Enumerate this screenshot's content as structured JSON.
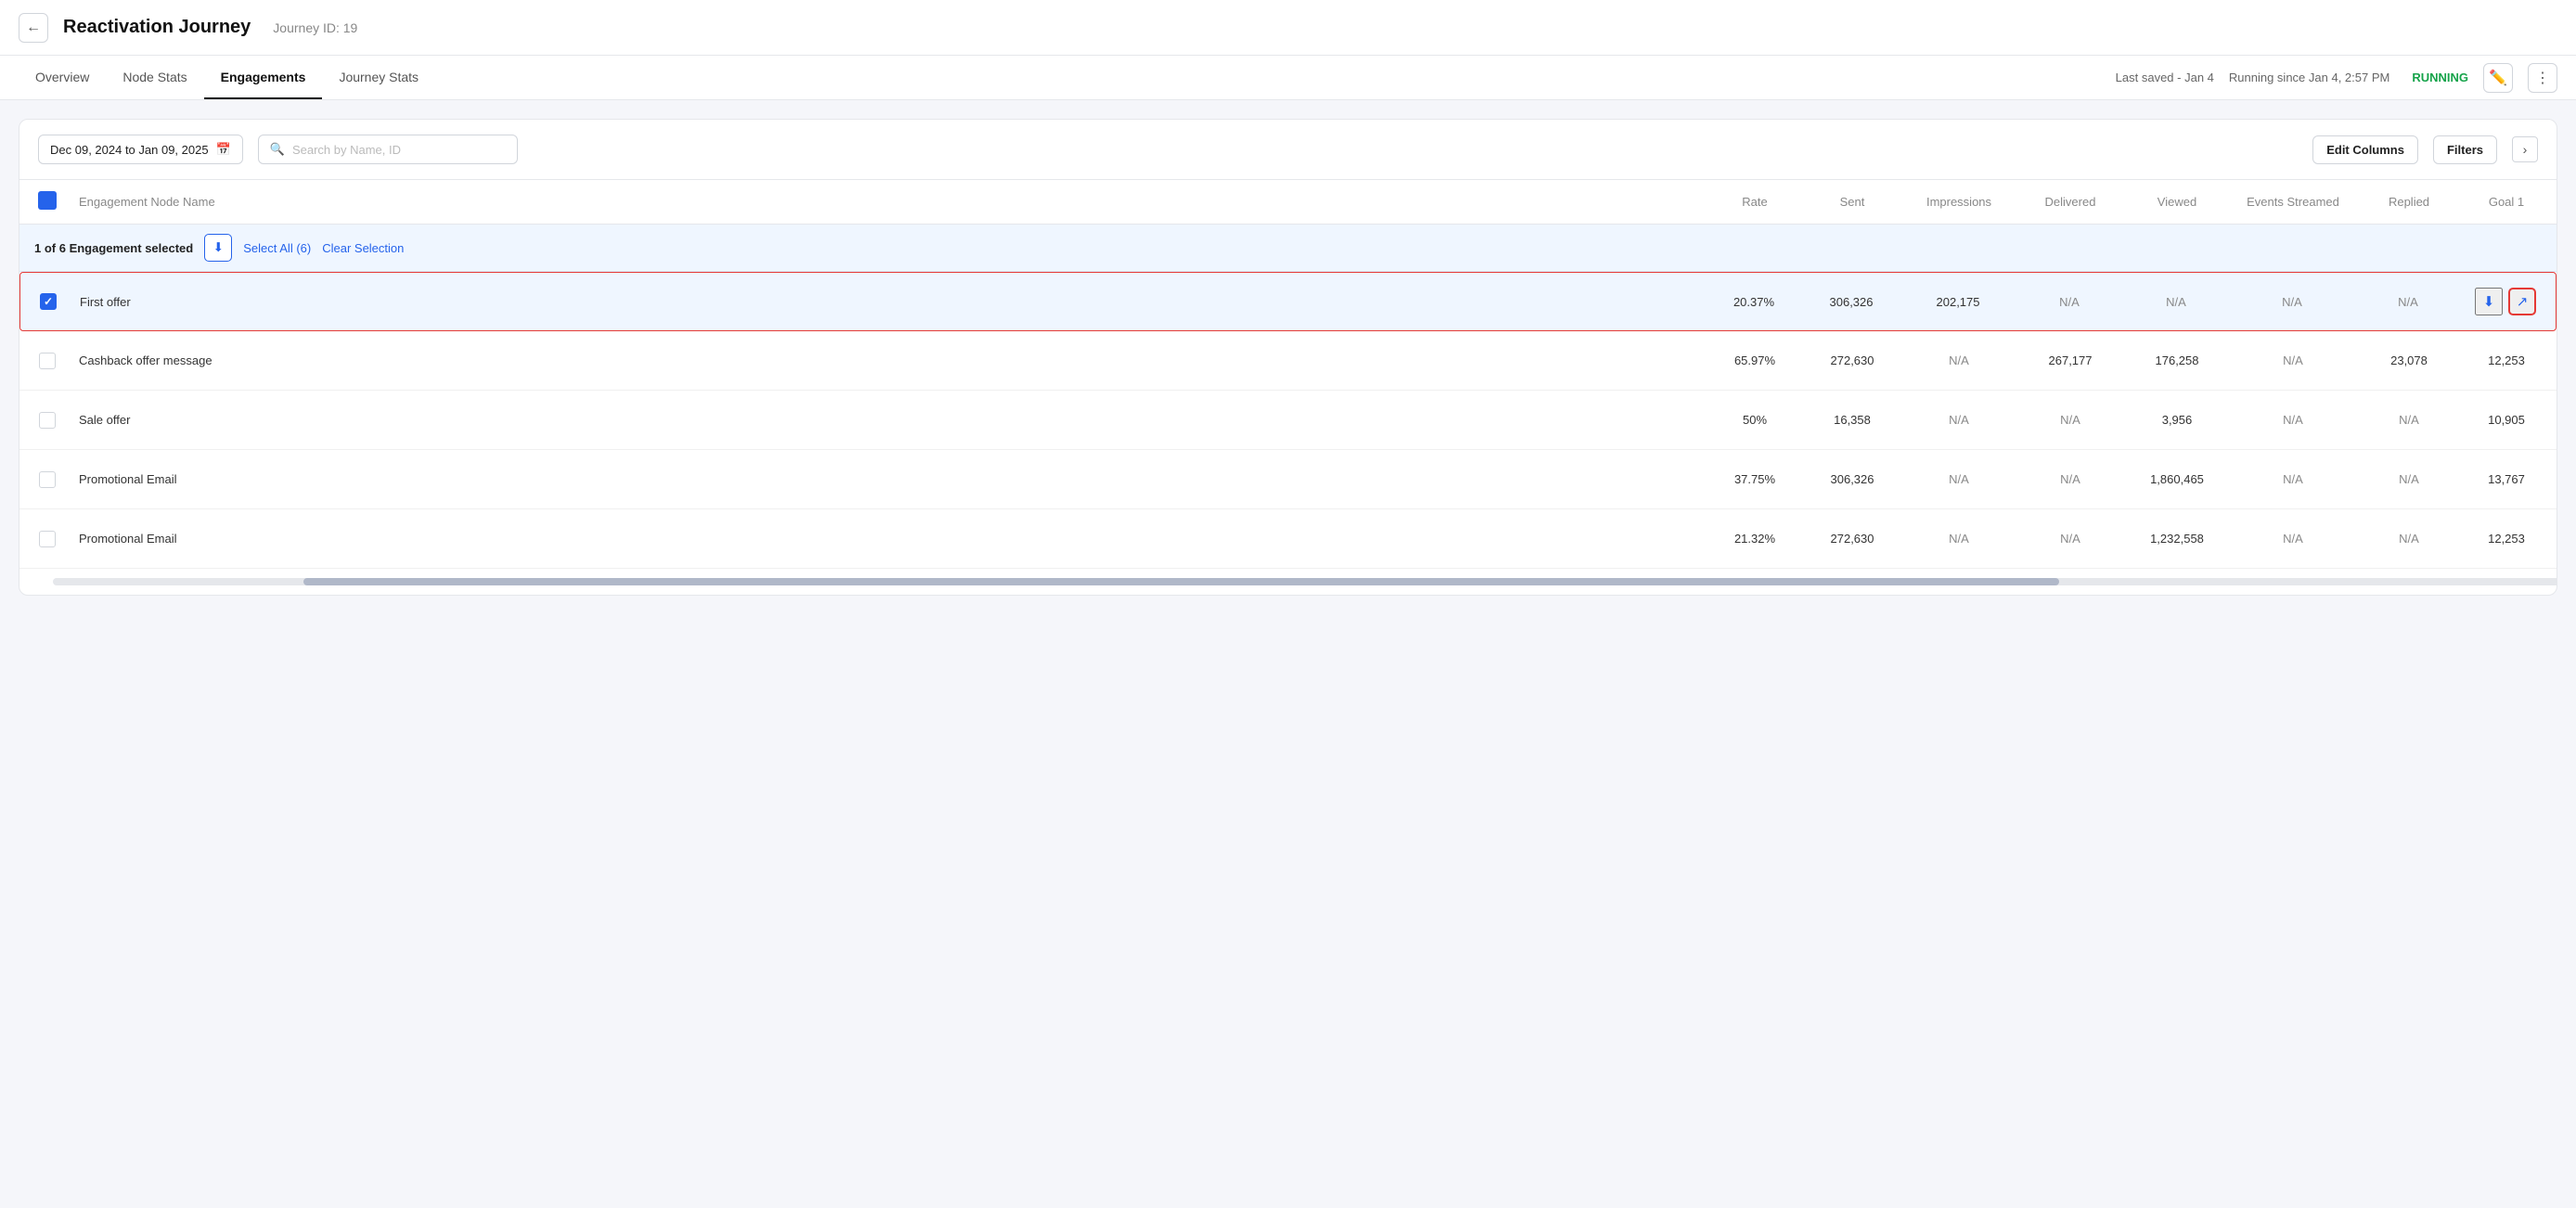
{
  "header": {
    "back_label": "←",
    "title": "Reactivation Journey",
    "journey_id_label": "Journey ID: 19"
  },
  "tabs": [
    {
      "id": "overview",
      "label": "Overview",
      "active": false
    },
    {
      "id": "node-stats",
      "label": "Node Stats",
      "active": false
    },
    {
      "id": "engagements",
      "label": "Engagements",
      "active": true
    },
    {
      "id": "journey-stats",
      "label": "Journey Stats",
      "active": false
    }
  ],
  "status_bar": {
    "last_saved": "Last saved - Jan 4",
    "running_since": "Running since Jan 4, 2:57 PM",
    "status": "RUNNING"
  },
  "toolbar": {
    "date_range": "Dec 09, 2024 to Jan 09, 2025",
    "search_placeholder": "Search by Name, ID",
    "edit_columns_label": "Edit Columns",
    "filters_label": "Filters"
  },
  "table": {
    "columns": [
      {
        "id": "checkbox",
        "label": ""
      },
      {
        "id": "name",
        "label": "Engagement Node Name"
      },
      {
        "id": "rate",
        "label": "Rate"
      },
      {
        "id": "sent",
        "label": "Sent"
      },
      {
        "id": "impressions",
        "label": "Impressions"
      },
      {
        "id": "delivered",
        "label": "Delivered"
      },
      {
        "id": "viewed",
        "label": "Viewed"
      },
      {
        "id": "events_streamed",
        "label": "Events Streamed"
      },
      {
        "id": "replied",
        "label": "Replied"
      },
      {
        "id": "goal1",
        "label": "Goal 1"
      }
    ],
    "selection_bar": {
      "text": "1 of 6 Engagement selected",
      "select_all_label": "Select All (6)",
      "clear_selection_label": "Clear Selection"
    },
    "rows": [
      {
        "id": 1,
        "selected": true,
        "name": "First offer",
        "rate": "20.37%",
        "sent": "306,326",
        "impressions": "202,175",
        "delivered": "N/A",
        "viewed": "N/A",
        "events_streamed": "N/A",
        "replied": "N/A",
        "goal1": "",
        "has_actions": true
      },
      {
        "id": 2,
        "selected": false,
        "name": "Cashback offer message",
        "rate": "65.97%",
        "sent": "272,630",
        "impressions": "N/A",
        "delivered": "267,177",
        "viewed": "176,258",
        "events_streamed": "N/A",
        "replied": "23,078",
        "goal1": "12,253",
        "has_actions": false
      },
      {
        "id": 3,
        "selected": false,
        "name": "Sale offer",
        "rate": "50%",
        "sent": "16,358",
        "impressions": "N/A",
        "delivered": "N/A",
        "viewed": "3,956",
        "events_streamed": "N/A",
        "replied": "N/A",
        "goal1": "10,905",
        "has_actions": false
      },
      {
        "id": 4,
        "selected": false,
        "name": "Promotional Email",
        "rate": "37.75%",
        "sent": "306,326",
        "impressions": "N/A",
        "delivered": "N/A",
        "viewed": "1,860,465",
        "events_streamed": "N/A",
        "replied": "N/A",
        "goal1": "13,767",
        "has_actions": false
      },
      {
        "id": 5,
        "selected": false,
        "name": "Promotional Email",
        "rate": "21.32%",
        "sent": "272,630",
        "impressions": "N/A",
        "delivered": "N/A",
        "viewed": "1,232,558",
        "events_streamed": "N/A",
        "replied": "N/A",
        "goal1": "12,253",
        "has_actions": false
      }
    ]
  }
}
